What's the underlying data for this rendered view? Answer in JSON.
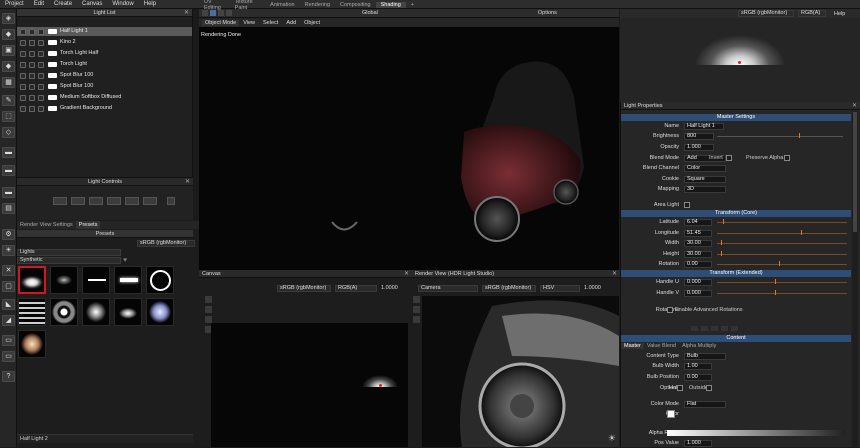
{
  "menu": [
    "Project",
    "Edit",
    "Create",
    "Canvas",
    "Window",
    "Help"
  ],
  "workspace_tabs": [
    "UV Editing",
    "Texture Paint",
    "Animation",
    "Rendering",
    "Compositing",
    "Shading",
    "+"
  ],
  "active_workspace": "Shading",
  "vp_toolbar": {
    "global": "Global",
    "options": "Options"
  },
  "subbar": [
    "Object Mode",
    "View",
    "Select",
    "Add",
    "Object"
  ],
  "viewport_status": "Rendering Done",
  "light_list": {
    "title": "Light List",
    "items": [
      {
        "name": "Half Light 1",
        "selected": true
      },
      {
        "name": "Kino 2"
      },
      {
        "name": "Torch Light Half"
      },
      {
        "name": "Torch Light"
      },
      {
        "name": "Spot Blur 100"
      },
      {
        "name": "Spot Blur 100"
      },
      {
        "name": "Medium Softbox Diffused"
      },
      {
        "name": "Gradient Background"
      }
    ]
  },
  "light_controls": {
    "title": "Light Controls"
  },
  "presets": {
    "tabs": [
      "Render View Settings",
      "Presets"
    ],
    "title": "Presets",
    "colorspace": "sRGB (rgbMonitor)",
    "category": "Lights",
    "subcategory": "Synthetic",
    "selected_label": "Half Light 2"
  },
  "canvas": {
    "title": "Canvas",
    "colorspace": "sRGB (rgbMonitor)",
    "channels": "RGB(A)",
    "value": "1.0000"
  },
  "render_view": {
    "title": "Render View (HDR Light Studio)",
    "camera": "Camera",
    "colorspace": "sRGB (rgbMonitor)",
    "mode": "HSV",
    "value": "1.0000"
  },
  "right_top": {
    "colorspace": "sRGB (rgbMonitor)",
    "channels": "RGB(A)",
    "help": "Help"
  },
  "props": {
    "title": "Light Properties",
    "master": "Master Settings",
    "rows": [
      {
        "label": "Name",
        "value": "Half Light 1"
      },
      {
        "label": "Brightness",
        "value": "800"
      },
      {
        "label": "Opacity",
        "value": "1.000"
      },
      {
        "label": "Blend Mode",
        "value": "Add"
      },
      {
        "label": "Blend Channel",
        "value": "Color"
      },
      {
        "label": "Cookie",
        "value": "Square"
      },
      {
        "label": "Mapping",
        "value": "3D"
      }
    ],
    "invert": "Invert",
    "preserve_alpha": "Preserve Alpha",
    "area_light": "Area Light",
    "transform_core": "Transform (Core)",
    "core_rows": [
      {
        "label": "Latitude",
        "value": "6.04"
      },
      {
        "label": "Longitude",
        "value": "51.45"
      },
      {
        "label": "Width",
        "value": "30.00"
      },
      {
        "label": "Height",
        "value": "30.00"
      },
      {
        "label": "Rotation",
        "value": "0.00"
      }
    ],
    "transform_ext": "Transform (Extended)",
    "ext_rows": [
      {
        "label": "Handle U",
        "value": "0.000"
      },
      {
        "label": "Handle V",
        "value": "0.000"
      }
    ],
    "rotations": "Rotations",
    "enable_adv": "Enable Advanced Rotations",
    "content": "Content",
    "content_tabs": [
      "Master",
      "Value Blend",
      "Alpha Multiply"
    ],
    "content_rows": [
      {
        "label": "Content Type",
        "value": "Bulb"
      },
      {
        "label": "Bulb Width",
        "value": "1.00"
      },
      {
        "label": "Bulb Position",
        "value": "0.00"
      }
    ],
    "options": "Options",
    "half": "Half",
    "outside": "Outside",
    "color_mode_label": "Color Mode",
    "color_mode": "Flat",
    "color_label": "Color",
    "alpha_ramp": "Alpha Ramp",
    "ramp_value_label": "Pos Value",
    "ramp_value": "1.000"
  }
}
